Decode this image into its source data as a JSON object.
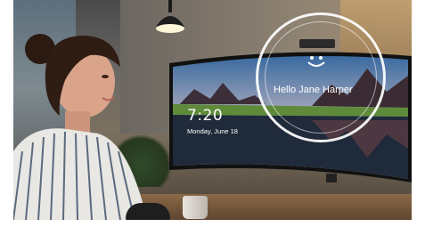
{
  "screen": {
    "time": "7:20",
    "date": "Monday, June 18",
    "greeting": "Hello Jane Harper"
  },
  "colors": {
    "screen_sky_top": "#3a6aa0",
    "screen_sky_bottom": "#e7c29c",
    "ring": "#ffffff",
    "grass": "#5f8a3a",
    "water": "#1f2a3a"
  },
  "icons": {
    "face_recognition": "smiley-icon",
    "camera": "webcam-icon"
  }
}
